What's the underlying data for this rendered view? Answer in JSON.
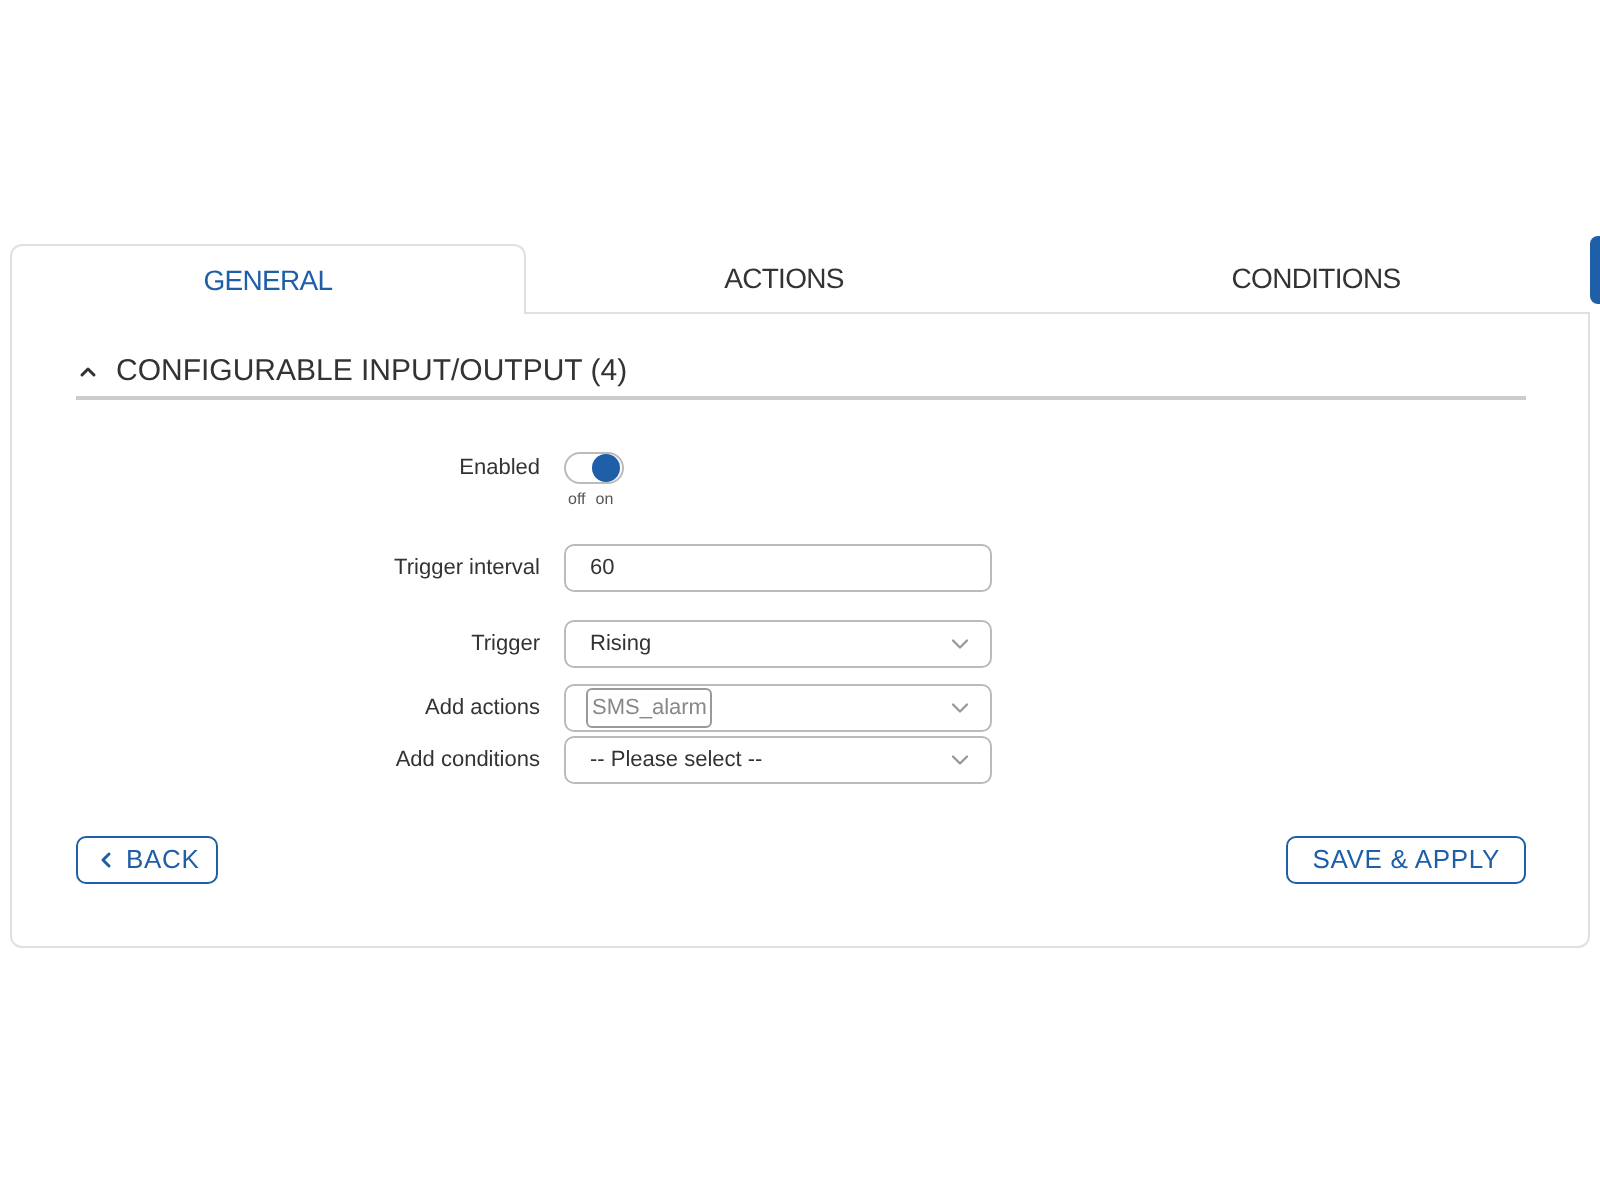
{
  "tabs": [
    {
      "label": "GENERAL",
      "selected": true
    },
    {
      "label": "ACTIONS",
      "selected": false
    },
    {
      "label": "CONDITIONS",
      "selected": false
    }
  ],
  "section": {
    "title": "CONFIGURABLE INPUT/OUTPUT (4)",
    "expanded": true
  },
  "fields": [
    {
      "kind": "toggle",
      "label": "Enabled",
      "on": true,
      "off_label": "off",
      "on_label": "on"
    },
    {
      "kind": "text",
      "label": "Trigger interval",
      "value": "60"
    },
    {
      "kind": "select",
      "label": "Trigger",
      "value": "Rising"
    },
    {
      "kind": "tags",
      "label": "Add actions",
      "tags": [
        "SMS_alarm"
      ]
    },
    {
      "kind": "select",
      "label": "Add conditions",
      "value": "-- Please select --"
    }
  ],
  "buttons": {
    "back": "BACK",
    "save": "SAVE & APPLY"
  }
}
